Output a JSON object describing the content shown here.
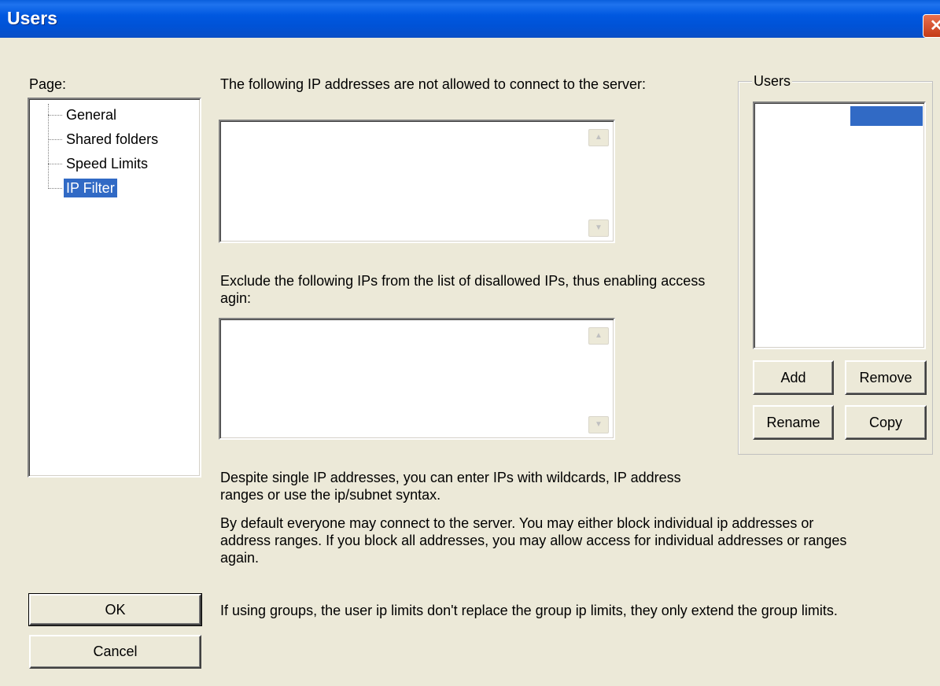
{
  "window": {
    "title": "Users",
    "close_glyph": "✕"
  },
  "page_panel": {
    "label": "Page:",
    "items": [
      {
        "label": "General",
        "selected": false
      },
      {
        "label": "Shared folders",
        "selected": false
      },
      {
        "label": "Speed Limits",
        "selected": false
      },
      {
        "label": "IP Filter",
        "selected": true
      }
    ]
  },
  "ip_filter": {
    "disallowed_label": "The following IP addresses are not allowed to connect to the server:",
    "disallowed_value": "",
    "allowed_label": "Exclude the following IPs from the list of disallowed IPs, thus enabling access agin:",
    "allowed_value": "",
    "help_1": "Despite single IP addresses, you can enter IPs with wildcards, IP address ranges or use the ip/subnet syntax.",
    "help_2": "By default everyone may connect to the server. You may either block individual ip addresses or address ranges. If you block all addresses, you may allow access for individual addresses or ranges again.",
    "help_3": "If using groups, the user ip limits don't replace the group ip limits, they only extend the group limits."
  },
  "users_group": {
    "label": "Users",
    "add_label": "Add",
    "remove_label": "Remove",
    "rename_label": "Rename",
    "copy_label": "Copy"
  },
  "footer": {
    "ok_label": "OK",
    "cancel_label": "Cancel"
  },
  "colors": {
    "selection": "#316ac5",
    "titlebar": "#0058e0",
    "dialog_bg": "#ece9d8"
  }
}
